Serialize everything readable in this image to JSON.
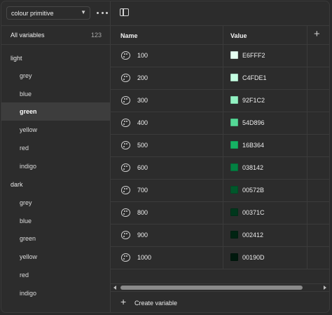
{
  "collection": {
    "selected": "colour primitive"
  },
  "sidebar": {
    "all_variables_label": "All variables",
    "all_variables_count": "123",
    "groups": [
      {
        "title": "light",
        "items": [
          "grey",
          "blue",
          "green",
          "yellow",
          "red",
          "indigo"
        ],
        "active": "green"
      },
      {
        "title": "dark",
        "items": [
          "grey",
          "blue",
          "green",
          "yellow",
          "red",
          "indigo"
        ]
      }
    ]
  },
  "table": {
    "headers": {
      "name": "Name",
      "value": "Value"
    },
    "rows": [
      {
        "name": "100",
        "hex": "E6FFF2",
        "color": "#E6FFF2"
      },
      {
        "name": "200",
        "hex": "C4FDE1",
        "color": "#C4FDE1"
      },
      {
        "name": "300",
        "hex": "92F1C2",
        "color": "#92F1C2"
      },
      {
        "name": "400",
        "hex": "54D896",
        "color": "#54D896"
      },
      {
        "name": "500",
        "hex": "16B364",
        "color": "#16B364"
      },
      {
        "name": "600",
        "hex": "038142",
        "color": "#038142"
      },
      {
        "name": "700",
        "hex": "00572B",
        "color": "#00572B"
      },
      {
        "name": "800",
        "hex": "00371C",
        "color": "#00371C"
      },
      {
        "name": "900",
        "hex": "002412",
        "color": "#002412"
      },
      {
        "name": "1000",
        "hex": "00190D",
        "color": "#00190D"
      }
    ]
  },
  "footer": {
    "create_label": "Create variable"
  },
  "icons": {
    "collection_dropdown": "chevron-down-icon",
    "more": "more-horizontal-icon",
    "panel": "sidebar-panel-icon",
    "row": "palette-icon",
    "add_column": "plus-icon",
    "create": "plus-icon"
  }
}
